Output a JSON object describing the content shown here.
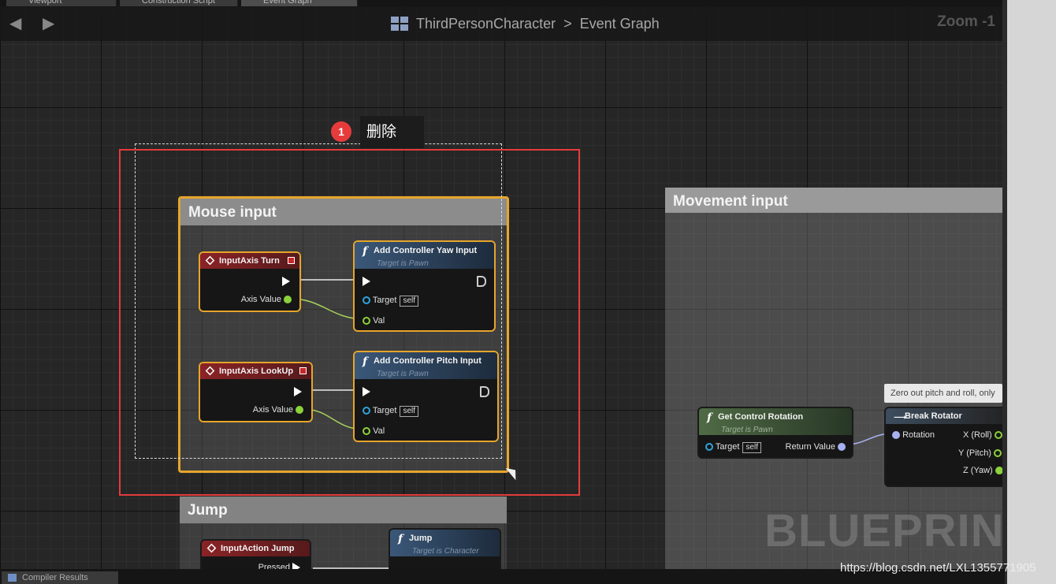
{
  "tabs": [
    {
      "label": "Viewport"
    },
    {
      "label": "Construction Script"
    },
    {
      "label": "Event Graph"
    }
  ],
  "header": {
    "breadcrumb_root": "ThirdPersonCharacter",
    "breadcrumb_sep": ">",
    "breadcrumb_leaf": "Event Graph",
    "zoom": "Zoom -1"
  },
  "annotation": {
    "badge": "1",
    "label": "删除"
  },
  "comments": {
    "mouse": "Mouse input",
    "jump": "Jump",
    "movement": "Movement input"
  },
  "nodes": {
    "turn": {
      "title": "InputAxis Turn",
      "axis_value": "Axis Value"
    },
    "yaw": {
      "title": "Add Controller Yaw Input",
      "subtitle": "Target is Pawn",
      "target": "Target",
      "self": "self",
      "val": "Val"
    },
    "lookup": {
      "title": "InputAxis LookUp",
      "axis_value": "Axis Value"
    },
    "pitch": {
      "title": "Add Controller Pitch Input",
      "subtitle": "Target is Pawn",
      "target": "Target",
      "self": "self",
      "val": "Val"
    },
    "jump_evt": {
      "title": "InputAction Jump",
      "pressed": "Pressed"
    },
    "jump_fn": {
      "title": "Jump",
      "subtitle": "Target is Character"
    },
    "get_rot": {
      "title": "Get Control Rotation",
      "subtitle": "Target is Pawn",
      "target": "Target",
      "self": "self",
      "return": "Return Value"
    },
    "break_rot": {
      "title": "Break Rotator",
      "rotation": "Rotation",
      "x": "X (Roll)",
      "y": "Y (Pitch)",
      "z": "Z (Yaw)"
    }
  },
  "tooltip": "Zero out pitch and roll, only",
  "graph_watermark": "BLUEPRINT",
  "bottom": {
    "tab": "Compiler Results"
  },
  "site_watermark": "https://blog.csdn.net/LXL1355771905"
}
